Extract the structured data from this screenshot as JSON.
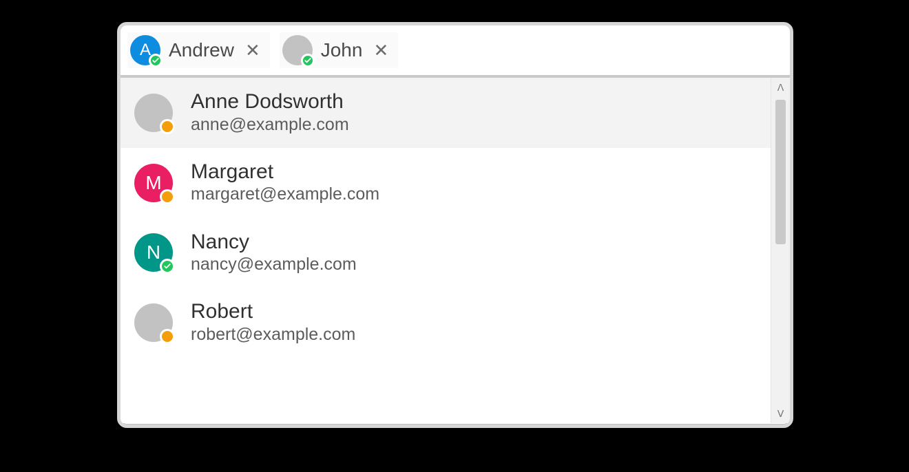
{
  "colors": {
    "blue": "#0d8ce0",
    "grey": "#c2c2c2",
    "crimson": "#e91e63",
    "teal": "#009688",
    "green_badge": "#22c55e",
    "orange_badge": "#f59e0b"
  },
  "tokens": [
    {
      "label": "Andrew",
      "avatar_letter": "A",
      "avatar_color": "blue",
      "status": "green"
    },
    {
      "label": "John",
      "avatar_letter": "",
      "avatar_color": "grey",
      "status": "green"
    }
  ],
  "suggestions": [
    {
      "name": "Anne Dodsworth",
      "email": "anne@example.com",
      "avatar_letter": "",
      "avatar_color": "grey",
      "status": "orange",
      "highlight": true
    },
    {
      "name": "Margaret",
      "email": "margaret@example.com",
      "avatar_letter": "M",
      "avatar_color": "crimson",
      "status": "orange",
      "highlight": false
    },
    {
      "name": "Nancy",
      "email": "nancy@example.com",
      "avatar_letter": "N",
      "avatar_color": "teal",
      "status": "green",
      "highlight": false
    },
    {
      "name": "Robert",
      "email": "robert@example.com",
      "avatar_letter": "",
      "avatar_color": "grey",
      "status": "orange",
      "highlight": false
    }
  ],
  "glyphs": {
    "close": "✕",
    "chevron_up": "ᐱ",
    "chevron_down": "ᐯ"
  }
}
